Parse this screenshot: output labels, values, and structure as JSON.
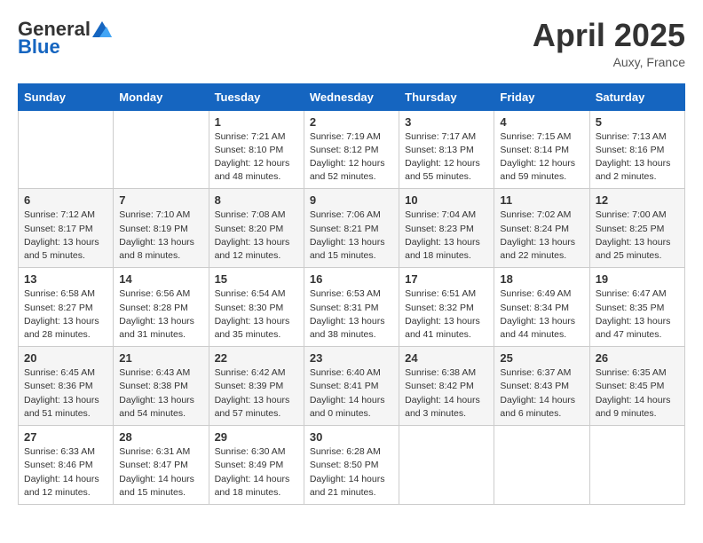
{
  "logo": {
    "general": "General",
    "blue": "Blue"
  },
  "title": "April 2025",
  "location": "Auxy, France",
  "days_header": [
    "Sunday",
    "Monday",
    "Tuesday",
    "Wednesday",
    "Thursday",
    "Friday",
    "Saturday"
  ],
  "weeks": [
    [
      {
        "day": "",
        "info": ""
      },
      {
        "day": "",
        "info": ""
      },
      {
        "day": "1",
        "info": "Sunrise: 7:21 AM\nSunset: 8:10 PM\nDaylight: 12 hours and 48 minutes."
      },
      {
        "day": "2",
        "info": "Sunrise: 7:19 AM\nSunset: 8:12 PM\nDaylight: 12 hours and 52 minutes."
      },
      {
        "day": "3",
        "info": "Sunrise: 7:17 AM\nSunset: 8:13 PM\nDaylight: 12 hours and 55 minutes."
      },
      {
        "day": "4",
        "info": "Sunrise: 7:15 AM\nSunset: 8:14 PM\nDaylight: 12 hours and 59 minutes."
      },
      {
        "day": "5",
        "info": "Sunrise: 7:13 AM\nSunset: 8:16 PM\nDaylight: 13 hours and 2 minutes."
      }
    ],
    [
      {
        "day": "6",
        "info": "Sunrise: 7:12 AM\nSunset: 8:17 PM\nDaylight: 13 hours and 5 minutes."
      },
      {
        "day": "7",
        "info": "Sunrise: 7:10 AM\nSunset: 8:19 PM\nDaylight: 13 hours and 8 minutes."
      },
      {
        "day": "8",
        "info": "Sunrise: 7:08 AM\nSunset: 8:20 PM\nDaylight: 13 hours and 12 minutes."
      },
      {
        "day": "9",
        "info": "Sunrise: 7:06 AM\nSunset: 8:21 PM\nDaylight: 13 hours and 15 minutes."
      },
      {
        "day": "10",
        "info": "Sunrise: 7:04 AM\nSunset: 8:23 PM\nDaylight: 13 hours and 18 minutes."
      },
      {
        "day": "11",
        "info": "Sunrise: 7:02 AM\nSunset: 8:24 PM\nDaylight: 13 hours and 22 minutes."
      },
      {
        "day": "12",
        "info": "Sunrise: 7:00 AM\nSunset: 8:25 PM\nDaylight: 13 hours and 25 minutes."
      }
    ],
    [
      {
        "day": "13",
        "info": "Sunrise: 6:58 AM\nSunset: 8:27 PM\nDaylight: 13 hours and 28 minutes."
      },
      {
        "day": "14",
        "info": "Sunrise: 6:56 AM\nSunset: 8:28 PM\nDaylight: 13 hours and 31 minutes."
      },
      {
        "day": "15",
        "info": "Sunrise: 6:54 AM\nSunset: 8:30 PM\nDaylight: 13 hours and 35 minutes."
      },
      {
        "day": "16",
        "info": "Sunrise: 6:53 AM\nSunset: 8:31 PM\nDaylight: 13 hours and 38 minutes."
      },
      {
        "day": "17",
        "info": "Sunrise: 6:51 AM\nSunset: 8:32 PM\nDaylight: 13 hours and 41 minutes."
      },
      {
        "day": "18",
        "info": "Sunrise: 6:49 AM\nSunset: 8:34 PM\nDaylight: 13 hours and 44 minutes."
      },
      {
        "day": "19",
        "info": "Sunrise: 6:47 AM\nSunset: 8:35 PM\nDaylight: 13 hours and 47 minutes."
      }
    ],
    [
      {
        "day": "20",
        "info": "Sunrise: 6:45 AM\nSunset: 8:36 PM\nDaylight: 13 hours and 51 minutes."
      },
      {
        "day": "21",
        "info": "Sunrise: 6:43 AM\nSunset: 8:38 PM\nDaylight: 13 hours and 54 minutes."
      },
      {
        "day": "22",
        "info": "Sunrise: 6:42 AM\nSunset: 8:39 PM\nDaylight: 13 hours and 57 minutes."
      },
      {
        "day": "23",
        "info": "Sunrise: 6:40 AM\nSunset: 8:41 PM\nDaylight: 14 hours and 0 minutes."
      },
      {
        "day": "24",
        "info": "Sunrise: 6:38 AM\nSunset: 8:42 PM\nDaylight: 14 hours and 3 minutes."
      },
      {
        "day": "25",
        "info": "Sunrise: 6:37 AM\nSunset: 8:43 PM\nDaylight: 14 hours and 6 minutes."
      },
      {
        "day": "26",
        "info": "Sunrise: 6:35 AM\nSunset: 8:45 PM\nDaylight: 14 hours and 9 minutes."
      }
    ],
    [
      {
        "day": "27",
        "info": "Sunrise: 6:33 AM\nSunset: 8:46 PM\nDaylight: 14 hours and 12 minutes."
      },
      {
        "day": "28",
        "info": "Sunrise: 6:31 AM\nSunset: 8:47 PM\nDaylight: 14 hours and 15 minutes."
      },
      {
        "day": "29",
        "info": "Sunrise: 6:30 AM\nSunset: 8:49 PM\nDaylight: 14 hours and 18 minutes."
      },
      {
        "day": "30",
        "info": "Sunrise: 6:28 AM\nSunset: 8:50 PM\nDaylight: 14 hours and 21 minutes."
      },
      {
        "day": "",
        "info": ""
      },
      {
        "day": "",
        "info": ""
      },
      {
        "day": "",
        "info": ""
      }
    ]
  ]
}
